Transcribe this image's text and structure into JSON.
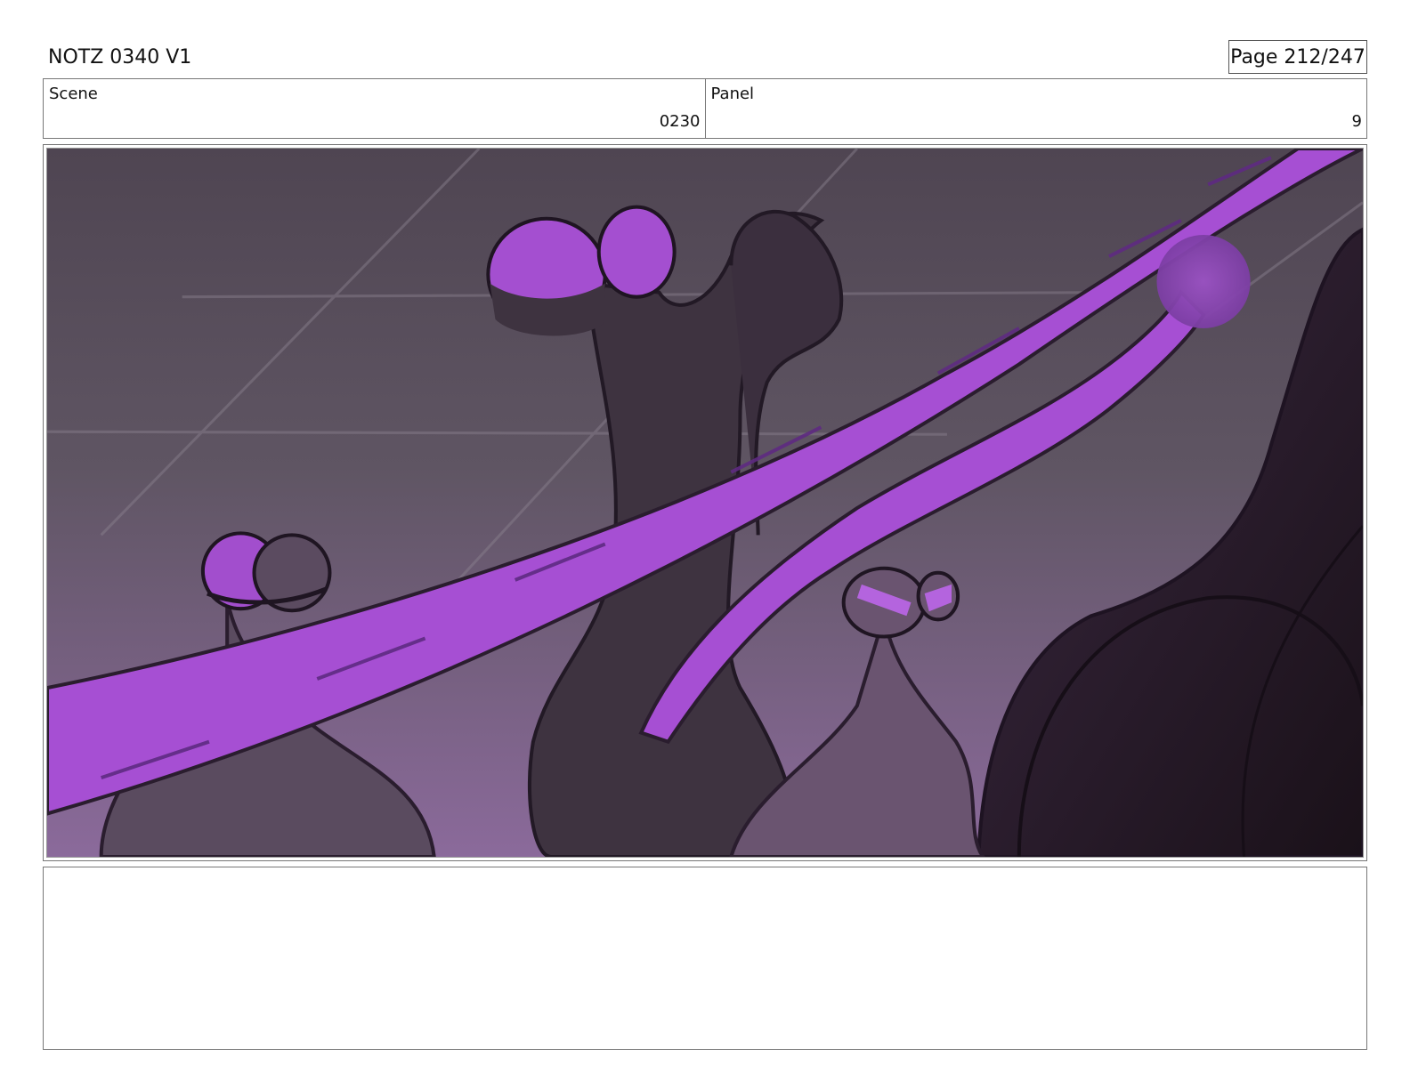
{
  "header": {
    "title": "NOTZ 0340 V1",
    "page": "Page 212/247"
  },
  "scene": {
    "label": "Scene",
    "value": "0230"
  },
  "panel": {
    "label": "Panel",
    "value": "9"
  },
  "notes": {
    "text": ""
  },
  "colors": {
    "beam": "#a54fd1",
    "beam_dark": "#6e2f92",
    "bg_top": "#4e4652",
    "bg_bottom": "#8a6a99",
    "ink": "#2a1d2e"
  }
}
